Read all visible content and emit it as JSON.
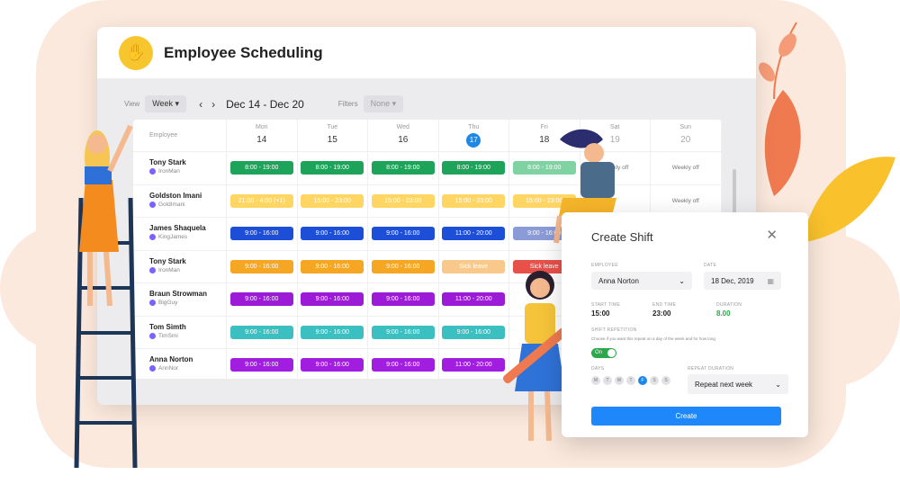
{
  "app": {
    "title": "Employee Scheduling",
    "logo_icon": "hand-icon"
  },
  "toolbar": {
    "view_label": "View",
    "view_value": "Week",
    "prev": "‹",
    "next": "›",
    "range": "Dec 14 - Dec 20",
    "filter_label": "Filters",
    "filter_value": "None"
  },
  "grid": {
    "employee_header": "Employee",
    "days": [
      {
        "name": "Mon",
        "num": "14"
      },
      {
        "name": "Tue",
        "num": "15"
      },
      {
        "name": "Wed",
        "num": "16"
      },
      {
        "name": "Thu",
        "num": "17"
      },
      {
        "name": "Fri",
        "num": "18"
      },
      {
        "name": "Sat",
        "num": "19"
      },
      {
        "name": "Sun",
        "num": "20"
      }
    ],
    "rows": [
      {
        "name": "Tony Stark",
        "handle": "IronMan",
        "cells": [
          {
            "t": "8:00 - 19:00",
            "c": "#1ea35a"
          },
          {
            "t": "8:00 - 19:00",
            "c": "#1ea35a"
          },
          {
            "t": "8:00 - 19:00",
            "c": "#1ea35a"
          },
          {
            "t": "8:00 - 19:00",
            "c": "#1ea35a"
          },
          {
            "t": "8:00 - 19:00",
            "c": "#7fd3a2"
          },
          {
            "t": "Weekly off",
            "off": true
          },
          {
            "t": "Weekly off",
            "off": true
          }
        ]
      },
      {
        "name": "Goldston Imani",
        "handle": "GoldImani",
        "cells": [
          {
            "t": "21:00 - 4:00 (+1)",
            "c": "#ffd664"
          },
          {
            "t": "15:00 - 23:00",
            "c": "#ffd664"
          },
          {
            "t": "15:00 - 23:00",
            "c": "#ffd664"
          },
          {
            "t": "15:00 - 23:00",
            "c": "#ffd664"
          },
          {
            "t": "15:00 - 23:00",
            "c": "#ffd664"
          },
          {
            "t": "",
            "off": true
          },
          {
            "t": "Weekly off",
            "off": true
          }
        ]
      },
      {
        "name": "James Shaquela",
        "handle": "KingJames",
        "cells": [
          {
            "t": "9:00 - 16:00",
            "c": "#1c4ed8"
          },
          {
            "t": "9:00 - 16:00",
            "c": "#1c4ed8"
          },
          {
            "t": "9:00 - 16:00",
            "c": "#1c4ed8"
          },
          {
            "t": "11:00 - 20:00",
            "c": "#1c4ed8"
          },
          {
            "t": "9:00 - 16:00",
            "c": "#8a9bd8"
          },
          {
            "t": "",
            "off": true
          },
          {
            "t": "",
            "off": true
          }
        ]
      },
      {
        "name": "Tony Stark",
        "handle": "IronMan",
        "cells": [
          {
            "t": "9:00 - 16:00",
            "c": "#f5a623"
          },
          {
            "t": "9:00 - 16:00",
            "c": "#f5a623"
          },
          {
            "t": "9:00 - 16:00",
            "c": "#f5a623"
          },
          {
            "t": "Sick leave",
            "c": "#f8c98a"
          },
          {
            "t": "Sick leave",
            "c": "#e8504a"
          },
          {
            "t": "",
            "off": true
          },
          {
            "t": "",
            "off": true
          }
        ]
      },
      {
        "name": "Braun Strowman",
        "handle": "BigGuy",
        "cells": [
          {
            "t": "9:00 - 16:00",
            "c": "#9b1bd6"
          },
          {
            "t": "9:00 - 16:00",
            "c": "#9b1bd6"
          },
          {
            "t": "9:00 - 16:00",
            "c": "#9b1bd6"
          },
          {
            "t": "11:00 - 20:00",
            "c": "#9b1bd6"
          },
          {
            "t": "",
            "off": true
          },
          {
            "t": "",
            "off": true
          },
          {
            "t": "",
            "off": true
          }
        ]
      },
      {
        "name": "Tom Simth",
        "handle": "TimSmi",
        "cells": [
          {
            "t": "9:00 - 16:00",
            "c": "#3bbfc0"
          },
          {
            "t": "9:00 - 16:00",
            "c": "#3bbfc0"
          },
          {
            "t": "9:00 - 16:00",
            "c": "#3bbfc0"
          },
          {
            "t": "9:00 - 16:00",
            "c": "#3bbfc0"
          },
          {
            "t": "",
            "off": true
          },
          {
            "t": "",
            "off": true
          },
          {
            "t": "",
            "off": true
          }
        ]
      },
      {
        "name": "Anna Norton",
        "handle": "AnnNor",
        "cells": [
          {
            "t": "9:00 - 16:00",
            "c": "#a11ee0"
          },
          {
            "t": "9:00 - 16:00",
            "c": "#a11ee0"
          },
          {
            "t": "9:00 - 16:00",
            "c": "#a11ee0"
          },
          {
            "t": "11:00 - 20:00",
            "c": "#a11ee0"
          },
          {
            "t": "",
            "off": true
          },
          {
            "t": "",
            "off": true
          },
          {
            "t": "",
            "off": true
          }
        ]
      }
    ]
  },
  "modal": {
    "title": "Create Shift",
    "close": "✕",
    "employee_label": "EMPLOYEE",
    "employee_value": "Anna Norton",
    "date_label": "DATE",
    "date_value": "18 Dec, 2019",
    "start_label": "START TIME",
    "start_value": "15:00",
    "end_label": "END TIME",
    "end_value": "23:00",
    "duration_label": "DURATION",
    "duration_value": "8.00",
    "repetition_label": "SHIFT REPETITION",
    "repetition_desc": "Choose if you want this repeat on a day of the week and for how long",
    "toggle_label": "On",
    "days_label": "DAYS",
    "days": [
      "M",
      "T",
      "W",
      "T",
      "F",
      "S",
      "S"
    ],
    "selected_day_index": 4,
    "repeat_label": "REPEAT DURATION",
    "repeat_value": "Repeat next week",
    "create_button": "Create"
  },
  "colors": {
    "accent": "#1e88fa",
    "toggle_on": "#2aa84a",
    "logo": "#f7c62f",
    "background_blob": "#fbe9dd"
  }
}
